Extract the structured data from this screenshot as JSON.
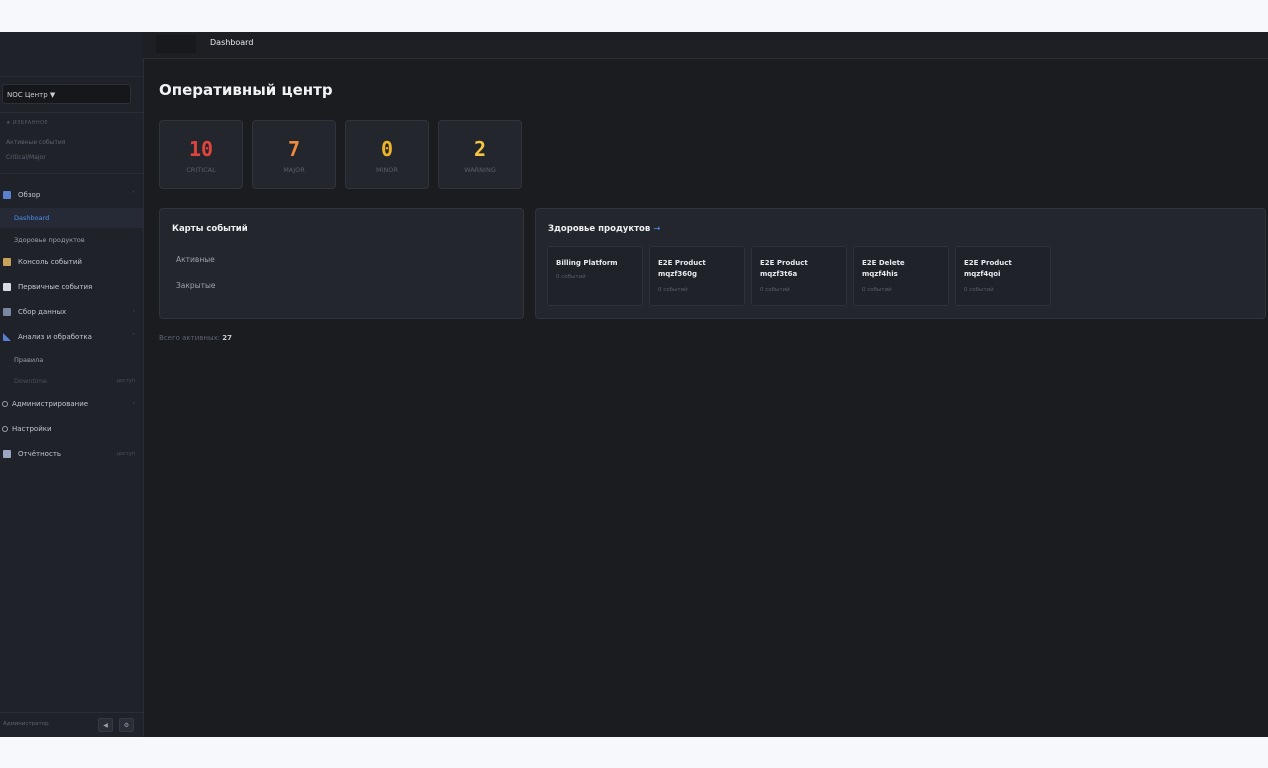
{
  "header": {
    "breadcrumb": "Dashboard"
  },
  "sidebar": {
    "org_select": "NOC Центр ▼",
    "favorites_label": "★ ИЗБРАННОЕ",
    "favorites": [
      "Активные события",
      "Critical/Major"
    ],
    "items": [
      {
        "label": "Обзор",
        "chevron": "˄"
      },
      {
        "label": "Dashboard"
      },
      {
        "label": "Здоровье продуктов"
      },
      {
        "label": "Консоль событий"
      },
      {
        "label": "Первичные события"
      },
      {
        "label": "Сбор данных",
        "chevron": "›"
      },
      {
        "label": "Анализ и обработка",
        "chevron": "˄"
      },
      {
        "label": "Правила"
      },
      {
        "label": "Downtime",
        "badge": "доступ"
      },
      {
        "label": "Администрирование",
        "chevron": "›"
      },
      {
        "label": "Настройки"
      },
      {
        "label": "Отчётность",
        "badge": "доступ"
      }
    ],
    "footer": {
      "user": "Администратор",
      "collapse_icon": "◀",
      "settings_icon": "⚙"
    }
  },
  "main": {
    "title": "Оперативный центр",
    "stats": [
      {
        "value": "10",
        "label": "CRITICAL",
        "color": "#e0443c"
      },
      {
        "value": "7",
        "label": "MAJOR",
        "color": "#f08a3c"
      },
      {
        "value": "0",
        "label": "MINOR",
        "color": "#f0b429"
      },
      {
        "value": "2",
        "label": "WARNING",
        "color": "#f5c542"
      }
    ],
    "event_maps": {
      "title": "Карты событий",
      "items": [
        "Активные",
        "Закрытые"
      ]
    },
    "product_health": {
      "title": "Здоровье продуктов",
      "link_arrow": "→",
      "products": [
        {
          "name": "Billing Platform",
          "count": "0 событий"
        },
        {
          "name": "E2E Product mqzf360g",
          "count": "0 событий"
        },
        {
          "name": "E2E Product mqzf3t6a",
          "count": "0 событий"
        },
        {
          "name": "E2E Delete mqzf4his",
          "count": "0 событий"
        },
        {
          "name": "E2E Product mqzf4qoi",
          "count": "0 событий"
        }
      ]
    },
    "total": {
      "label": "Всего активных:",
      "value": "27"
    }
  },
  "colors": {
    "accent": "#4d8ff0",
    "background": "#1b1c20",
    "sidebar": "#1f2229"
  }
}
